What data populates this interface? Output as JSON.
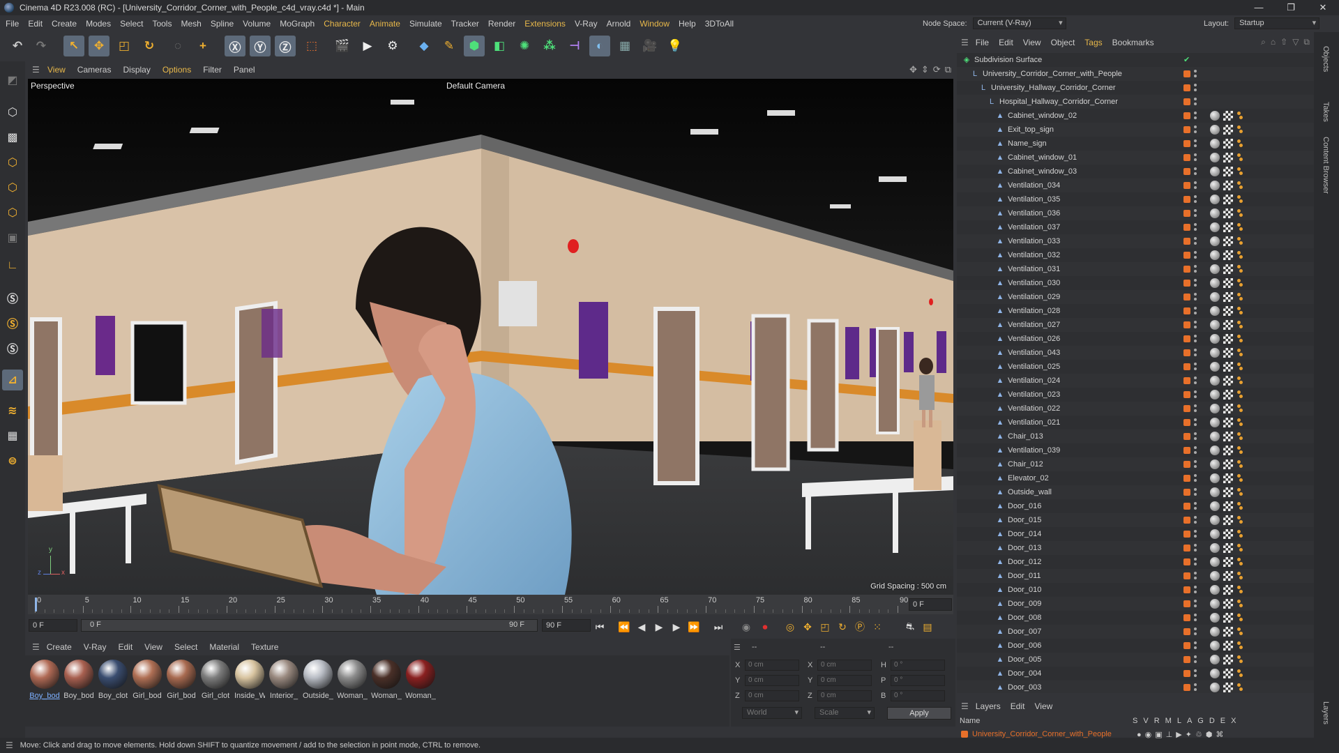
{
  "window": {
    "title": "Cinema 4D R23.008 (RC) - [University_Corridor_Corner_with_People_c4d_vray.c4d *] - Main",
    "minimize": "—",
    "maximize": "❐",
    "close": "✕"
  },
  "menubar": {
    "items": [
      "File",
      "Edit",
      "Create",
      "Modes",
      "Select",
      "Tools",
      "Mesh",
      "Spline",
      "Volume",
      "MoGraph",
      "Character",
      "Animate",
      "Simulate",
      "Tracker",
      "Render",
      "Extensions",
      "V-Ray",
      "Arnold",
      "Window",
      "Help",
      "3DToAll"
    ],
    "node_space_label": "Node Space:",
    "node_space_value": "Current (V-Ray)",
    "layout_label": "Layout:",
    "layout_value": "Startup"
  },
  "viewport": {
    "menu": [
      "View",
      "Cameras",
      "Display",
      "Options",
      "Filter",
      "Panel"
    ],
    "view_name": "Perspective",
    "camera": "Default Camera",
    "grid_spacing": "Grid Spacing : 500 cm",
    "axis_y": "y",
    "axis_z": "z",
    "axis_x": "x"
  },
  "timeline": {
    "ticks": [
      "0",
      "5",
      "10",
      "15",
      "20",
      "25",
      "30",
      "35",
      "40",
      "45",
      "50",
      "55",
      "60",
      "65",
      "70",
      "75",
      "80",
      "85",
      "90"
    ],
    "current_frame": "0 F"
  },
  "transport": {
    "start_field": "0 F",
    "range_start": "0 F",
    "range_end": "90 F",
    "end_field": "90 F"
  },
  "materials": {
    "menu": [
      "Create",
      "V-Ray",
      "Edit",
      "View",
      "Select",
      "Material",
      "Texture"
    ],
    "items": [
      {
        "name": "Boy_bod",
        "color": "#b06a55"
      },
      {
        "name": "Boy_bod",
        "color": "#a86050"
      },
      {
        "name": "Boy_clot",
        "color": "#3a4d70"
      },
      {
        "name": "Girl_bod",
        "color": "#b07055"
      },
      {
        "name": "Girl_bod",
        "color": "#a86a50"
      },
      {
        "name": "Girl_clot",
        "color": "#7d7d7d"
      },
      {
        "name": "Inside_W",
        "color": "#d8c4a0"
      },
      {
        "name": "Interior_",
        "color": "#9a8a80"
      },
      {
        "name": "Outside_",
        "color": "#b8bcc4"
      },
      {
        "name": "Woman_",
        "color": "#8c8c8c"
      },
      {
        "name": "Woman_",
        "color": "#4a3028"
      },
      {
        "name": "Woman_",
        "color": "#8a2020"
      }
    ]
  },
  "coords": {
    "header1": "--",
    "header2": "--",
    "header3": "--",
    "x_label": "X",
    "y_label": "Y",
    "z_label": "Z",
    "x_val": "0 cm",
    "y_val": "0 cm",
    "z_val": "0 cm",
    "x2_label": "X",
    "y2_label": "Y",
    "z2_label": "Z",
    "x2_val": "0 cm",
    "y2_val": "0 cm",
    "z2_val": "0 cm",
    "h_label": "H",
    "p_label": "P",
    "b_label": "B",
    "h_val": "0 °",
    "p_val": "0 °",
    "b_val": "0 °",
    "mode1": "World",
    "mode2": "Scale",
    "apply": "Apply"
  },
  "status": {
    "text": "Move: Click and drag to move elements. Hold down SHIFT to quantize movement / add to the selection in point mode, CTRL to remove."
  },
  "object_manager": {
    "menu": [
      "File",
      "Edit",
      "View",
      "Object",
      "Tags",
      "Bookmarks"
    ],
    "objects": [
      {
        "name": "Subdivision Surface",
        "indent": 0,
        "icon": "◈"
      },
      {
        "name": "University_Corridor_Corner_with_People",
        "indent": 1,
        "icon": "L"
      },
      {
        "name": "University_Hallway_Corridor_Corner",
        "indent": 2,
        "icon": "L"
      },
      {
        "name": "Hospital_Hallway_Corridor_Corner",
        "indent": 3,
        "icon": "L"
      },
      {
        "name": "Cabinet_window_02",
        "indent": 4,
        "icon": "▲"
      },
      {
        "name": "Exit_top_sign",
        "indent": 4,
        "icon": "▲"
      },
      {
        "name": "Name_sign",
        "indent": 4,
        "icon": "▲"
      },
      {
        "name": "Cabinet_window_01",
        "indent": 4,
        "icon": "▲"
      },
      {
        "name": "Cabinet_window_03",
        "indent": 4,
        "icon": "▲"
      },
      {
        "name": "Ventilation_034",
        "indent": 4,
        "icon": "▲"
      },
      {
        "name": "Ventilation_035",
        "indent": 4,
        "icon": "▲"
      },
      {
        "name": "Ventilation_036",
        "indent": 4,
        "icon": "▲"
      },
      {
        "name": "Ventilation_037",
        "indent": 4,
        "icon": "▲"
      },
      {
        "name": "Ventilation_033",
        "indent": 4,
        "icon": "▲"
      },
      {
        "name": "Ventilation_032",
        "indent": 4,
        "icon": "▲"
      },
      {
        "name": "Ventilation_031",
        "indent": 4,
        "icon": "▲"
      },
      {
        "name": "Ventilation_030",
        "indent": 4,
        "icon": "▲"
      },
      {
        "name": "Ventilation_029",
        "indent": 4,
        "icon": "▲"
      },
      {
        "name": "Ventilation_028",
        "indent": 4,
        "icon": "▲"
      },
      {
        "name": "Ventilation_027",
        "indent": 4,
        "icon": "▲"
      },
      {
        "name": "Ventilation_026",
        "indent": 4,
        "icon": "▲"
      },
      {
        "name": "Ventilation_043",
        "indent": 4,
        "icon": "▲"
      },
      {
        "name": "Ventilation_025",
        "indent": 4,
        "icon": "▲"
      },
      {
        "name": "Ventilation_024",
        "indent": 4,
        "icon": "▲"
      },
      {
        "name": "Ventilation_023",
        "indent": 4,
        "icon": "▲"
      },
      {
        "name": "Ventilation_022",
        "indent": 4,
        "icon": "▲"
      },
      {
        "name": "Ventilation_021",
        "indent": 4,
        "icon": "▲"
      },
      {
        "name": "Chair_013",
        "indent": 4,
        "icon": "▲"
      },
      {
        "name": "Ventilation_039",
        "indent": 4,
        "icon": "▲"
      },
      {
        "name": "Chair_012",
        "indent": 4,
        "icon": "▲"
      },
      {
        "name": "Elevator_02",
        "indent": 4,
        "icon": "▲"
      },
      {
        "name": "Outside_wall",
        "indent": 4,
        "icon": "▲"
      },
      {
        "name": "Door_016",
        "indent": 4,
        "icon": "▲"
      },
      {
        "name": "Door_015",
        "indent": 4,
        "icon": "▲"
      },
      {
        "name": "Door_014",
        "indent": 4,
        "icon": "▲"
      },
      {
        "name": "Door_013",
        "indent": 4,
        "icon": "▲"
      },
      {
        "name": "Door_012",
        "indent": 4,
        "icon": "▲"
      },
      {
        "name": "Door_011",
        "indent": 4,
        "icon": "▲"
      },
      {
        "name": "Door_010",
        "indent": 4,
        "icon": "▲"
      },
      {
        "name": "Door_009",
        "indent": 4,
        "icon": "▲"
      },
      {
        "name": "Door_008",
        "indent": 4,
        "icon": "▲"
      },
      {
        "name": "Door_007",
        "indent": 4,
        "icon": "▲"
      },
      {
        "name": "Door_006",
        "indent": 4,
        "icon": "▲"
      },
      {
        "name": "Door_005",
        "indent": 4,
        "icon": "▲"
      },
      {
        "name": "Door_004",
        "indent": 4,
        "icon": "▲"
      },
      {
        "name": "Door_003",
        "indent": 4,
        "icon": "▲"
      }
    ]
  },
  "layers": {
    "menu": [
      "Layers",
      "Edit",
      "View"
    ],
    "name_header": "Name",
    "columns": [
      "S",
      "V",
      "R",
      "M",
      "L",
      "A",
      "G",
      "D",
      "E",
      "X"
    ],
    "layer_name": "University_Corridor_Corner_with_People"
  },
  "side_tabs": [
    "Objects",
    "Takes",
    "Content Browser",
    "Layers"
  ]
}
